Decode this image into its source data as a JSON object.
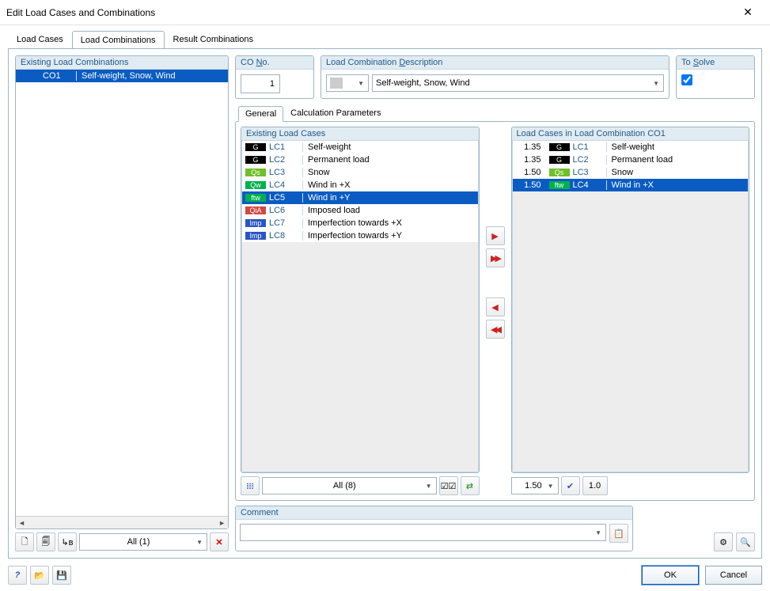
{
  "title": "Edit Load Cases and Combinations",
  "main_tabs": [
    "Load Cases",
    "Load Combinations",
    "Result Combinations"
  ],
  "active_main_tab": 1,
  "left": {
    "title": "Existing Load Combinations",
    "combos": [
      {
        "code": "CO1",
        "desc": "Self-weight, Snow, Wind"
      }
    ],
    "selected": 0,
    "filter": "All (1)"
  },
  "co_no": {
    "label_pre": "CO ",
    "label_u": "N",
    "label_post": "o.",
    "value": "1"
  },
  "description": {
    "label_pre": "Load Combination ",
    "label_u": "D",
    "label_post": "escription",
    "type_sel": "",
    "value": "Self-weight, Snow, Wind"
  },
  "to_solve": {
    "label_pre": "To ",
    "label_u": "S",
    "label_post": "olve",
    "checked": true
  },
  "sub_tabs": [
    "General",
    "Calculation Parameters"
  ],
  "active_sub_tab": 0,
  "existing_lc": {
    "title": "Existing Load Cases",
    "rows": [
      {
        "tag": "G",
        "code": "LC1",
        "desc": "Self-weight"
      },
      {
        "tag": "G",
        "code": "LC2",
        "desc": "Permanent load"
      },
      {
        "tag": "Qs",
        "code": "LC3",
        "desc": "Snow"
      },
      {
        "tag": "Qw",
        "code": "LC4",
        "desc": "Wind in +X"
      },
      {
        "tag": "ftw",
        "code": "LC5",
        "desc": "Wind in +Y"
      },
      {
        "tag": "QiA",
        "code": "LC6",
        "desc": "Imposed load"
      },
      {
        "tag": "Imp",
        "code": "LC7",
        "desc": "Imperfection towards +X"
      },
      {
        "tag": "Imp",
        "code": "LC8",
        "desc": "Imperfection towards +Y"
      }
    ],
    "selected": 4,
    "filter": "All (8)"
  },
  "in_combo": {
    "title": "Load Cases in Load Combination CO1",
    "rows": [
      {
        "factor": "1.35",
        "tag": "G",
        "code": "LC1",
        "desc": "Self-weight"
      },
      {
        "factor": "1.35",
        "tag": "G",
        "code": "LC2",
        "desc": "Permanent load"
      },
      {
        "factor": "1.50",
        "tag": "Qs",
        "code": "LC3",
        "desc": "Snow"
      },
      {
        "factor": "1.50",
        "tag": "ftw",
        "code": "LC4",
        "desc": "Wind in +X"
      }
    ],
    "selected": 3,
    "factor_input": "1.50",
    "reset_label": "1.0"
  },
  "comment": {
    "title": "Comment",
    "value": ""
  },
  "buttons": {
    "ok": "OK",
    "cancel": "Cancel"
  },
  "transfer": {
    "add": "➤",
    "add_all": "➤➤",
    "remove": "◀",
    "remove_all": "◀◀"
  },
  "icons": {
    "new": "🗋",
    "copy": "🗐",
    "apply_b": "↳ʙ",
    "delete": "✕",
    "filter": "𝍖",
    "check_multi": "☑☑",
    "swap": "⇄",
    "check": "✔",
    "pick": "📋",
    "options": "⚙",
    "details": "🔍",
    "help": "?",
    "open": "📂",
    "save": "💾",
    "left": "◄",
    "right": "►"
  }
}
